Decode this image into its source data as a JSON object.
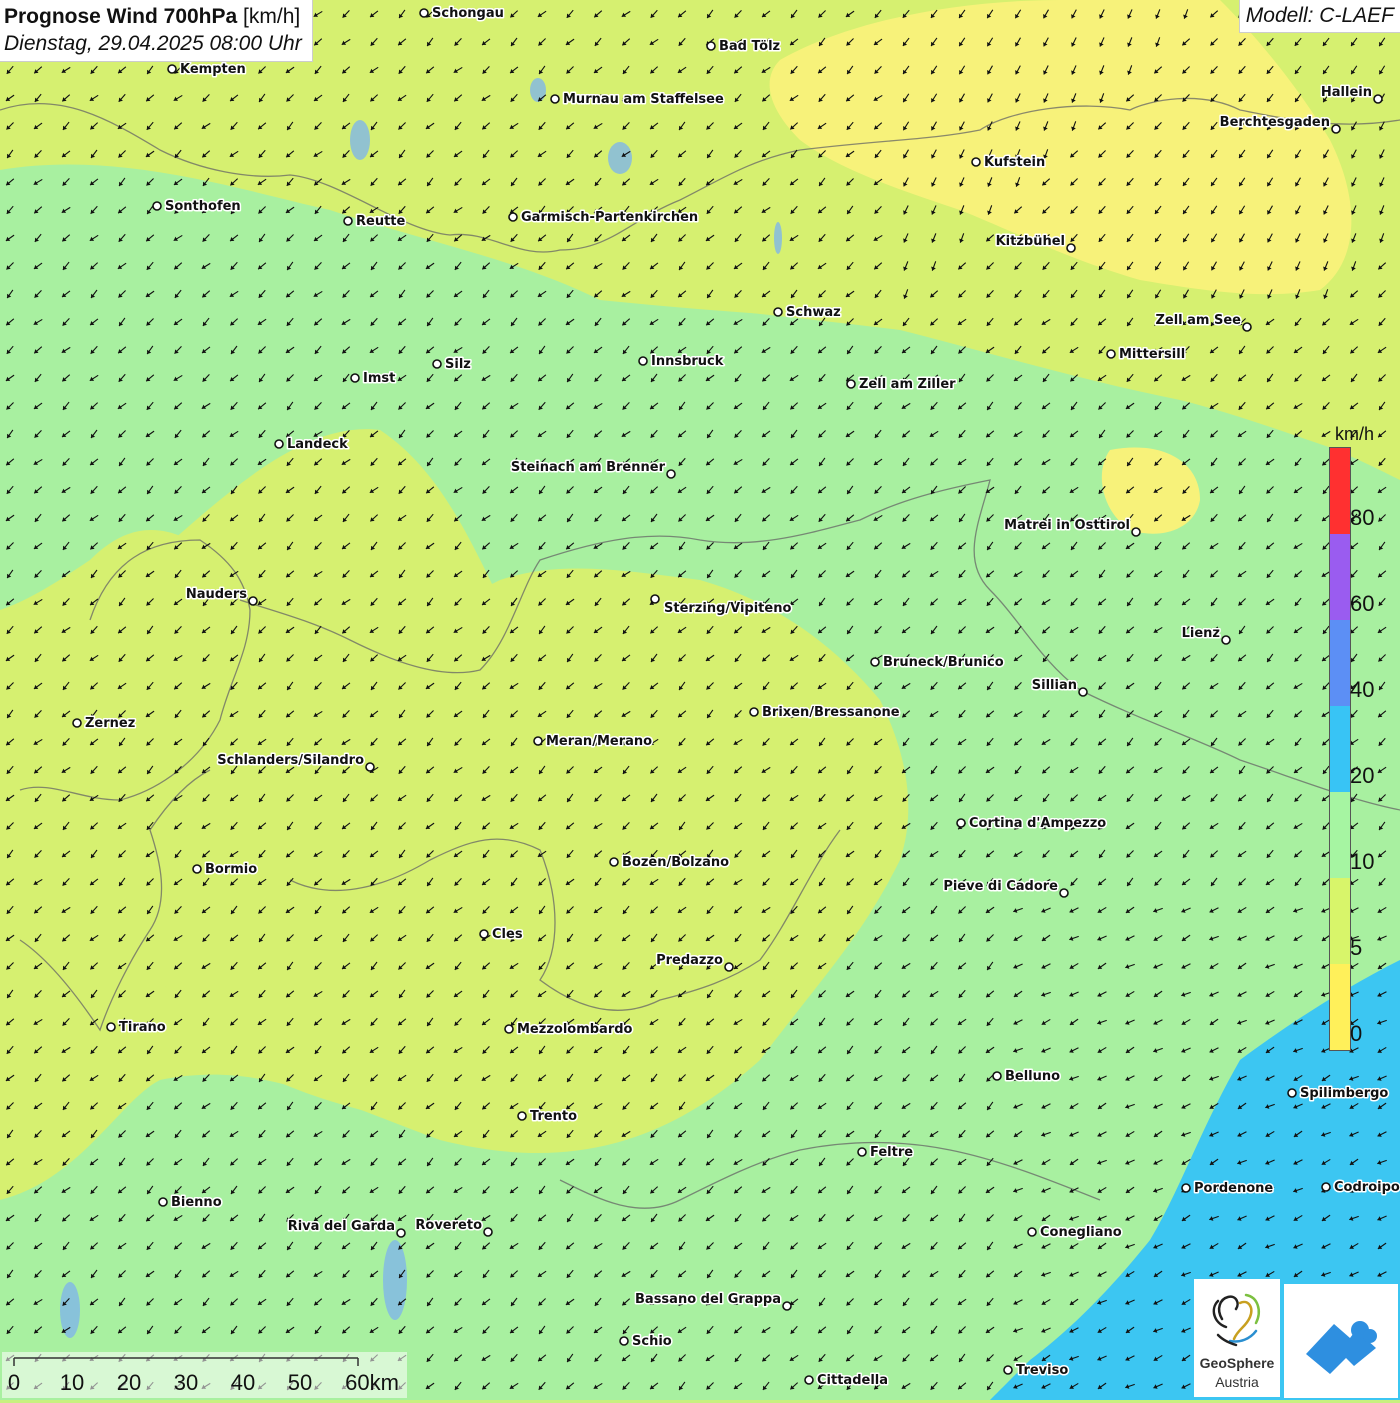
{
  "title": {
    "main": "Prognose Wind 700hPa",
    "unit": "[km/h]",
    "datetime": "Dienstag, 29.04.2025 08:00 Uhr"
  },
  "model": "Modell: C-LAEF",
  "legend": {
    "unit": "km/h",
    "ticks": [
      "80",
      "60",
      "40",
      "20",
      "10",
      "5",
      "0"
    ],
    "colors": [
      "#ff3030",
      "#9a5cf0",
      "#5c8ff5",
      "#38c4f5",
      "#a6f5a2",
      "#d8f56a",
      "#fff05a",
      "#ddf0f8"
    ]
  },
  "scalebar": {
    "ticks": [
      "0",
      "10",
      "20",
      "30",
      "40",
      "50",
      "60km"
    ]
  },
  "logo": {
    "line1": "GeoSphere",
    "line2": "Austria"
  },
  "colors": {
    "green": "#a8f0a0",
    "yellowgreen": "#d6f070",
    "yellow": "#f7f27a",
    "blue": "#3cc6f2"
  },
  "cities": [
    {
      "name": "Schongau"
    },
    {
      "name": "Bad Tölz"
    },
    {
      "name": "Kempten"
    },
    {
      "name": "Murnau am Staffelsee"
    },
    {
      "name": "Hallein"
    },
    {
      "name": "Berchtesgaden"
    },
    {
      "name": "Kufstein"
    },
    {
      "name": "Sonthofen"
    },
    {
      "name": "Reutte"
    },
    {
      "name": "Garmisch-Partenkirchen"
    },
    {
      "name": "Kitzbühel"
    },
    {
      "name": "Schwaz"
    },
    {
      "name": "Zell am See"
    },
    {
      "name": "Mittersill"
    },
    {
      "name": "Innsbruck"
    },
    {
      "name": "Silz"
    },
    {
      "name": "Imst"
    },
    {
      "name": "Zell am Ziller"
    },
    {
      "name": "Landeck"
    },
    {
      "name": "Steinach am Brenner"
    },
    {
      "name": "Matrei in Osttirol"
    },
    {
      "name": "Nauders"
    },
    {
      "name": "Sterzing/Vipiteno"
    },
    {
      "name": "Lienz"
    },
    {
      "name": "Bruneck/Brunico"
    },
    {
      "name": "Sillian"
    },
    {
      "name": "Zernez"
    },
    {
      "name": "Brixen/Bressanone"
    },
    {
      "name": "Meran/Merano"
    },
    {
      "name": "Schlanders/Silandro"
    },
    {
      "name": "Cortina d'Ampezzo"
    },
    {
      "name": "Bormio"
    },
    {
      "name": "Bozen/Bolzano"
    },
    {
      "name": "Pieve di Cadore"
    },
    {
      "name": "Cles"
    },
    {
      "name": "Predazzo"
    },
    {
      "name": "Tirano"
    },
    {
      "name": "Mezzolombardo"
    },
    {
      "name": "Belluno"
    },
    {
      "name": "Spilimbergo"
    },
    {
      "name": "Trento"
    },
    {
      "name": "Feltre"
    },
    {
      "name": "Pordenone"
    },
    {
      "name": "Codroipo"
    },
    {
      "name": "Bienno"
    },
    {
      "name": "Riva del Garda"
    },
    {
      "name": "Rovereto"
    },
    {
      "name": "Conegliano"
    },
    {
      "name": "Bassano del Grappa"
    },
    {
      "name": "Schio"
    },
    {
      "name": "Treviso"
    },
    {
      "name": "Cittadella"
    }
  ]
}
